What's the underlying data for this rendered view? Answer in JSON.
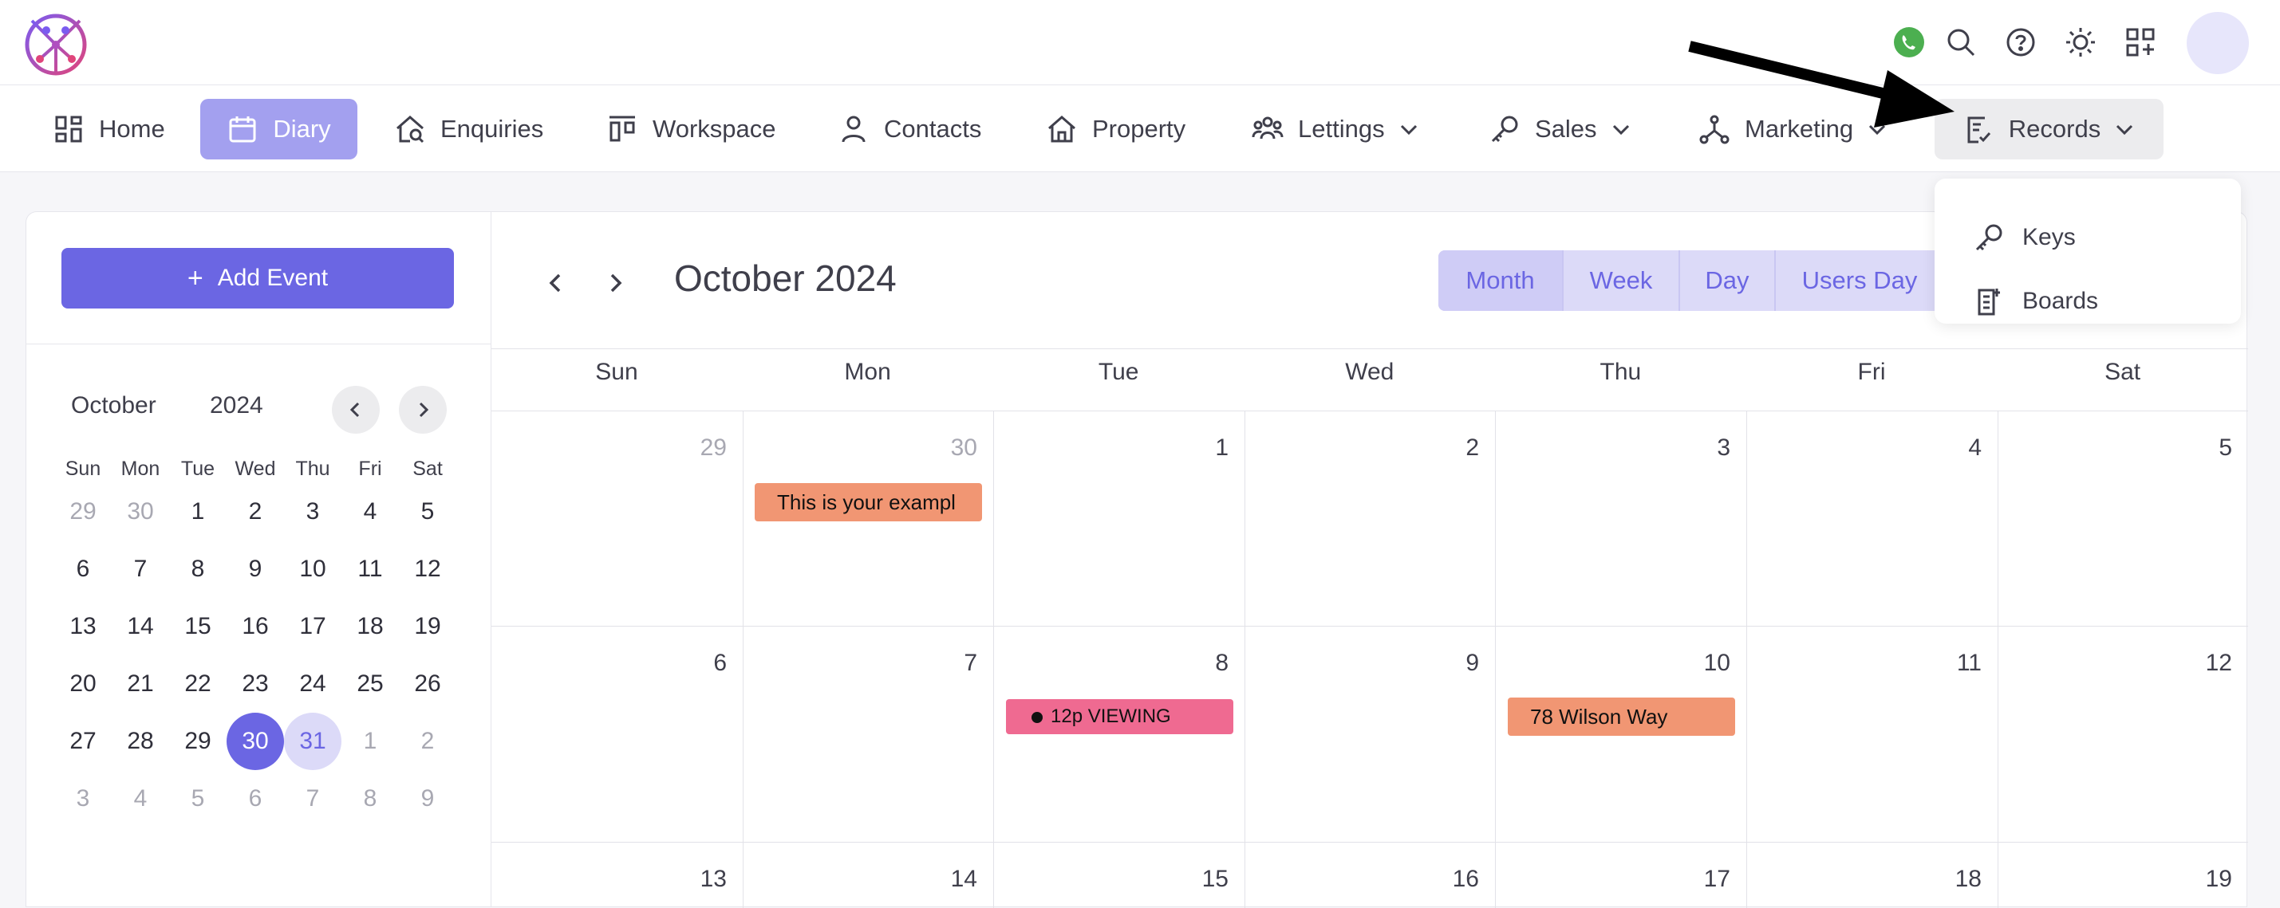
{
  "icons": {
    "whatsapp": "whatsapp-icon",
    "search": "search-icon",
    "help": "help-icon",
    "theme": "sun-icon",
    "apps": "apps-icon"
  },
  "nav": {
    "home": "Home",
    "diary": "Diary",
    "enquiries": "Enquiries",
    "workspace": "Workspace",
    "contacts": "Contacts",
    "property": "Property",
    "lettings": "Lettings",
    "sales": "Sales",
    "marketing": "Marketing",
    "records": "Records"
  },
  "records_menu": {
    "keys": "Keys",
    "boards": "Boards"
  },
  "sidebar": {
    "add_event": "Add Event",
    "month": "October",
    "year": "2024",
    "dow": [
      "Sun",
      "Mon",
      "Tue",
      "Wed",
      "Thu",
      "Fri",
      "Sat"
    ],
    "weeks": [
      [
        "29",
        "30",
        "1",
        "2",
        "3",
        "4",
        "5"
      ],
      [
        "6",
        "7",
        "8",
        "9",
        "10",
        "11",
        "12"
      ],
      [
        "13",
        "14",
        "15",
        "16",
        "17",
        "18",
        "19"
      ],
      [
        "20",
        "21",
        "22",
        "23",
        "24",
        "25",
        "26"
      ],
      [
        "27",
        "28",
        "29",
        "30",
        "31",
        "1",
        "2"
      ],
      [
        "3",
        "4",
        "5",
        "6",
        "7",
        "8",
        "9"
      ]
    ],
    "selected_day": "30",
    "highlighted_day": "31"
  },
  "calendar": {
    "title": "October 2024",
    "views": [
      "Month",
      "Week",
      "Day",
      "Users Day"
    ],
    "active_view": "Month",
    "dow": [
      "Sun",
      "Mon",
      "Tue",
      "Wed",
      "Thu",
      "Fri",
      "Sat"
    ],
    "weeks": [
      [
        "29",
        "30",
        "1",
        "2",
        "3",
        "4",
        "5"
      ],
      [
        "6",
        "7",
        "8",
        "9",
        "10",
        "11",
        "12"
      ],
      [
        "13",
        "14",
        "15",
        "16",
        "17",
        "18",
        "19"
      ]
    ],
    "events": [
      {
        "label": "This is your exampl",
        "color": "#f19673"
      },
      {
        "label": "12p VIEWING",
        "color": "#ef6a91"
      },
      {
        "label": "78 Wilson Way",
        "color": "#f19673"
      }
    ]
  },
  "colors": {
    "accent": "#6b66e3",
    "accent_light": "#dcdaf8",
    "nav_active": "#a3a0ef",
    "whatsapp": "#4caf50"
  }
}
